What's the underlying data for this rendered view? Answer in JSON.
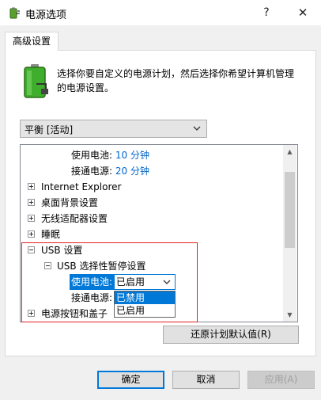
{
  "window": {
    "title": "电源选项",
    "help_glyph": "?",
    "close_glyph": "✕",
    "icon": "power-options-icon"
  },
  "tab": {
    "label": "高级设置"
  },
  "description": "选择你要自定义的电源计划，然后选择你希望计算机管理的电源设置。",
  "plan_select": {
    "value": "平衡 [活动]"
  },
  "tree": {
    "rows": [
      {
        "label": "使用电池:",
        "value": "10 分钟"
      },
      {
        "label": "接通电源:",
        "value": "20 分钟"
      },
      {
        "label": "Internet Explorer"
      },
      {
        "label": "桌面背景设置"
      },
      {
        "label": "无线适配器设置"
      },
      {
        "label": "睡眠"
      },
      {
        "label": "USB 设置"
      },
      {
        "label": "USB 选择性暂停设置"
      },
      {
        "label": "使用电池:"
      },
      {
        "label": "接通电源:"
      },
      {
        "label": "电源按钮和盖子"
      }
    ],
    "inline_select_value": "已启用",
    "dropdown_options": [
      "已禁用",
      "已启用"
    ],
    "dropdown_selected_index": 0
  },
  "buttons": {
    "restore": "还原计划默认值(R)",
    "ok": "确定",
    "cancel": "取消",
    "apply": "应用(A)"
  },
  "colors": {
    "accent": "#0078d7",
    "value_text": "#0066cc",
    "annotation_border": "#e02020"
  }
}
